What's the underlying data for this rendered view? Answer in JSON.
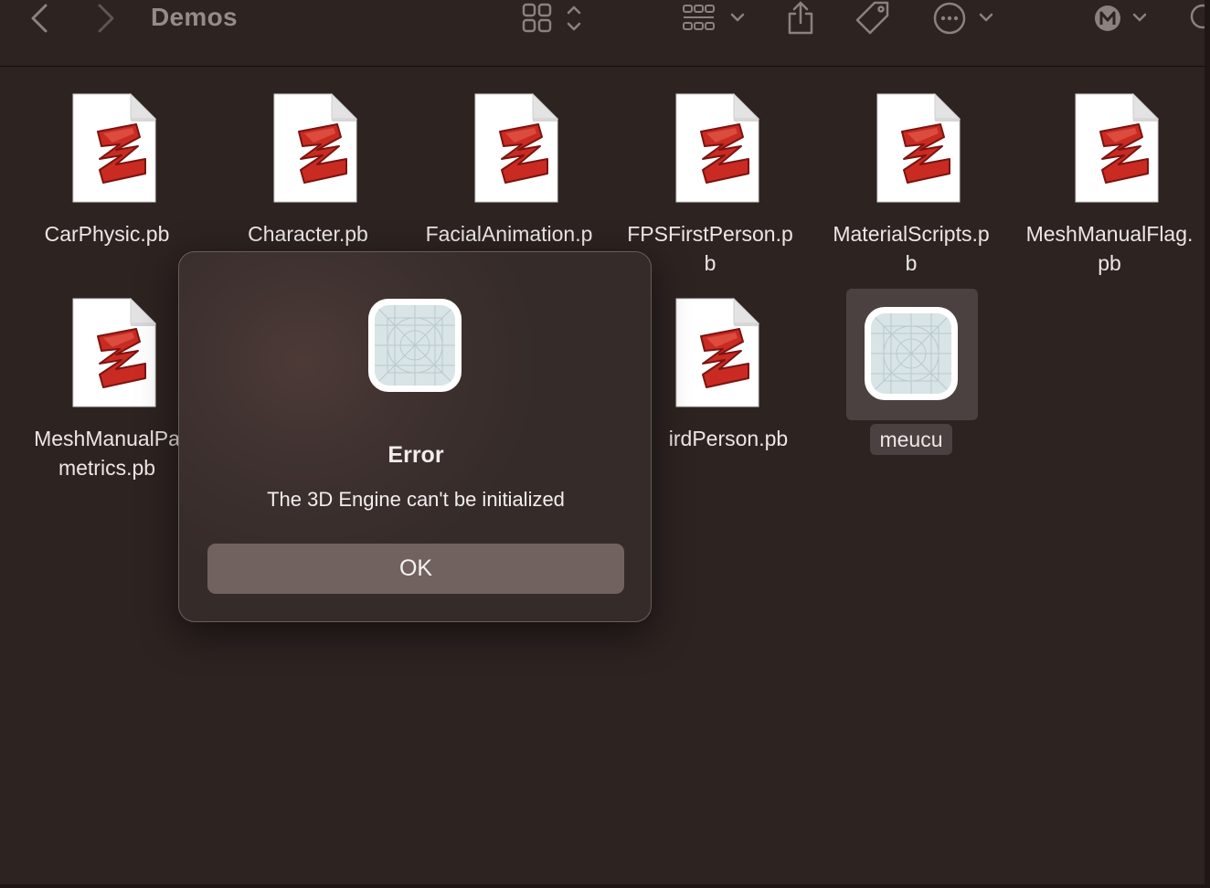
{
  "window": {
    "title": "Demos"
  },
  "toolbar": {
    "back_icon": "chevron-left-icon",
    "forward_icon": "chevron-right-icon",
    "view_icon": "icon-grid-icon",
    "group_icon": "group-grid-icon",
    "share_icon": "share-icon",
    "tag_icon": "tag-icon",
    "more_icon": "ellipsis-circle-icon",
    "account_icon": "m-circle-icon",
    "search_icon": "search-icon"
  },
  "files": [
    {
      "name": "CarPhysic.pb",
      "icon": "purebasic-file-icon"
    },
    {
      "name": "Character.pb",
      "icon": "purebasic-file-icon"
    },
    {
      "name": "FacialAnimation.p",
      "icon": "purebasic-file-icon"
    },
    {
      "name": "FPSFirstPerson.p\nb",
      "icon": "purebasic-file-icon"
    },
    {
      "name": "MaterialScripts.p\nb",
      "icon": "purebasic-file-icon"
    },
    {
      "name": "MeshManualFlag.\npb",
      "icon": "purebasic-file-icon"
    },
    {
      "name": "MeshManualPa\nmetrics.pb",
      "icon": "purebasic-file-icon"
    },
    {
      "name": "irdPerson.pb",
      "icon": "purebasic-file-icon"
    },
    {
      "name": "meucu",
      "icon": "generic-app-icon",
      "selected": true
    }
  ],
  "dialog": {
    "title": "Error",
    "message": "The 3D Engine can't be initialized",
    "ok_label": "OK",
    "icon": "generic-app-icon"
  },
  "colors": {
    "background": "#2d2321",
    "dialog_button": "#72625f",
    "selection": "#4a4140",
    "file_icon_red": "#c92a22"
  }
}
